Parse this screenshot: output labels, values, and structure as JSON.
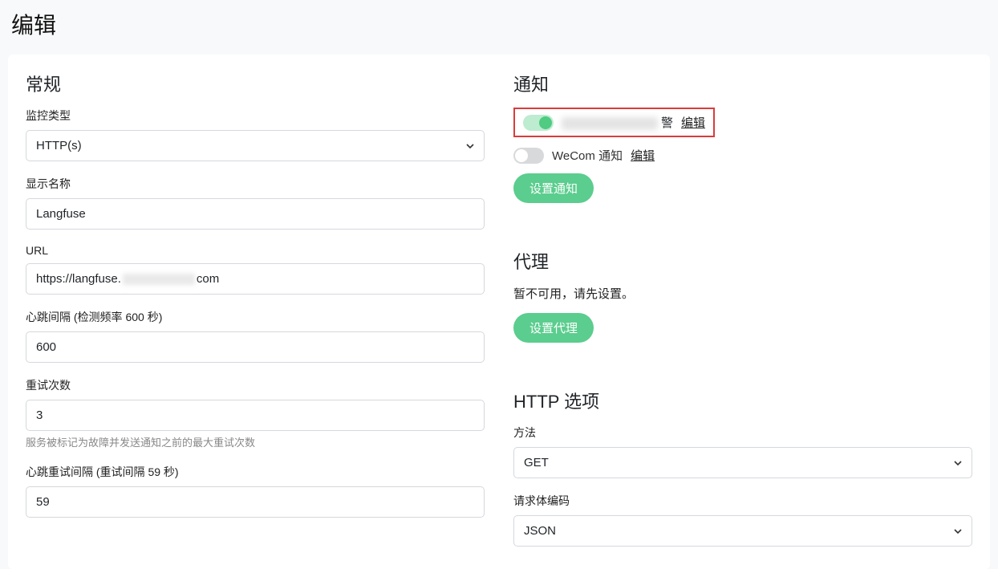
{
  "page": {
    "title": "编辑"
  },
  "general": {
    "title": "常规",
    "monitor_type": {
      "label": "监控类型",
      "value": "HTTP(s)"
    },
    "display_name": {
      "label": "显示名称",
      "value": "Langfuse"
    },
    "url": {
      "label": "URL",
      "prefix": "https://langfuse.",
      "suffix": "com"
    },
    "heartbeat_interval": {
      "label": "心跳间隔 (检测频率 600 秒)",
      "value": "600"
    },
    "retry": {
      "label": "重试次数",
      "value": "3",
      "help": "服务被标记为故障并发送通知之前的最大重试次数"
    },
    "heartbeat_retry": {
      "label": "心跳重试间隔 (重试间隔 59 秒)",
      "value": "59"
    }
  },
  "notifications": {
    "title": "通知",
    "items": [
      {
        "enabled": true,
        "name_redacted": true,
        "name_suffix": "警",
        "edit": "编辑"
      },
      {
        "enabled": false,
        "name": "WeCom 通知",
        "edit": "编辑"
      }
    ],
    "setup_btn": "设置通知"
  },
  "proxy": {
    "title": "代理",
    "note": "暂不可用，请先设置。",
    "setup_btn": "设置代理"
  },
  "http_options": {
    "title": "HTTP 选项",
    "method": {
      "label": "方法",
      "value": "GET"
    },
    "body_encoding": {
      "label": "请求体编码",
      "value": "JSON"
    }
  }
}
